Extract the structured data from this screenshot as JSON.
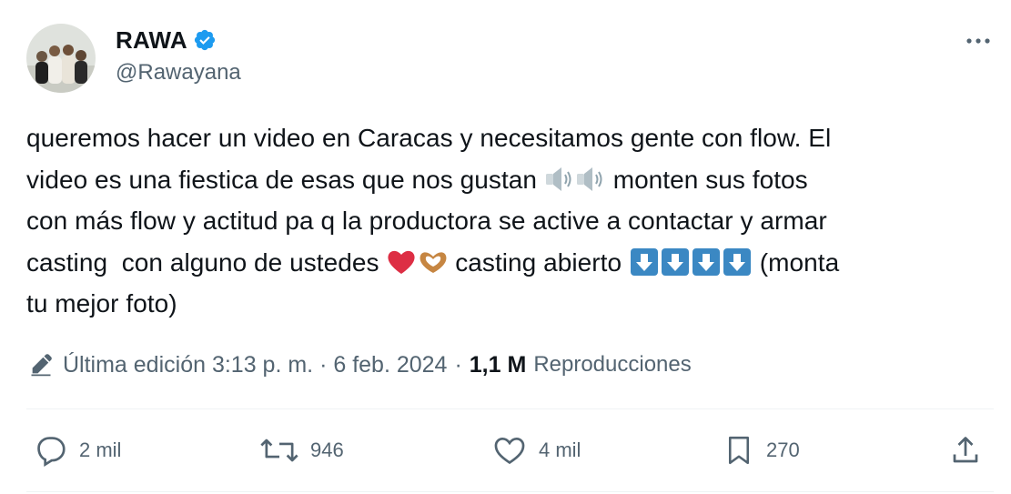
{
  "author": {
    "name": "RAWA",
    "handle": "@Rawayana"
  },
  "tweet": {
    "segments": {
      "s1": "queremos hacer un video en Caracas y necesitamos gente con flow. El\nvideo es una fiestica de esas que nos gustan ",
      "s2": " monten sus fotos\ncon más flow y actitud pa q la productora se active a contactar y armar\ncasting  con alguno de ustedes ",
      "s3": " casting abierto ",
      "s4": " (monta\ntu mejor foto)"
    },
    "emojis": [
      "speaker-loud-emoji",
      "speaker-loud-emoji",
      "red-heart-emoji",
      "heart-hands-emoji",
      "down-arrow-emoji",
      "down-arrow-emoji",
      "down-arrow-emoji",
      "down-arrow-emoji"
    ]
  },
  "meta": {
    "edited_label": "Última edición 3:13 p. m. · 6 feb. 2024",
    "separator": "·",
    "views_count": "1,1 M",
    "views_label": "Reproducciones"
  },
  "actions": {
    "replies": "2 mil",
    "reposts": "946",
    "likes": "4 mil",
    "bookmarks": "270"
  },
  "colors": {
    "text": "#0f1419",
    "secondary": "#536471",
    "verified": "#1d9bf0",
    "divider": "#eff3f4",
    "arrow_emoji": "#3b88c3",
    "heart": "#dd2e44"
  }
}
